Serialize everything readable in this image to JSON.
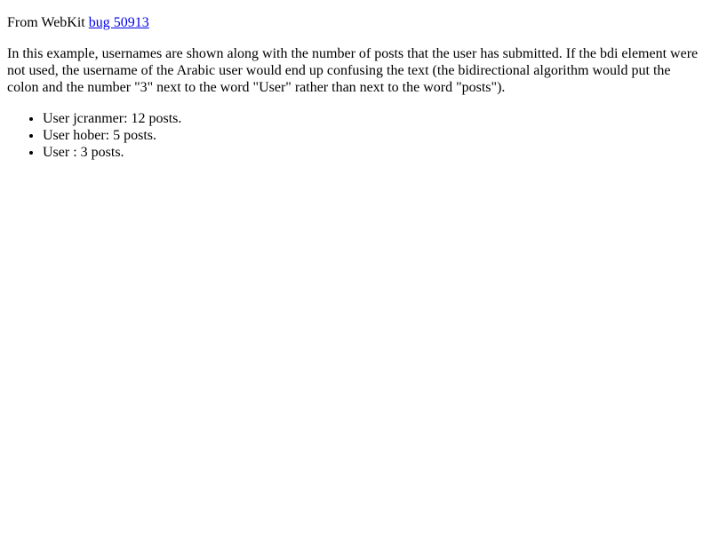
{
  "header": {
    "prefix": "From WebKit ",
    "link_text": "bug 50913"
  },
  "intro": {
    "text": "In this example, usernames are shown along with the number of posts that the user has submitted. If the bdi element were not used, the username of the Arabic user would end up confusing the text (the bidirectional algorithm would put the colon and the number \"3\" next to the word \"User\" rather than next to the word \"posts\")."
  },
  "users": [
    {
      "text": "User jcranmer: 12 posts."
    },
    {
      "text": "User hober: 5 posts."
    },
    {
      "text": "User : 3 posts."
    }
  ]
}
